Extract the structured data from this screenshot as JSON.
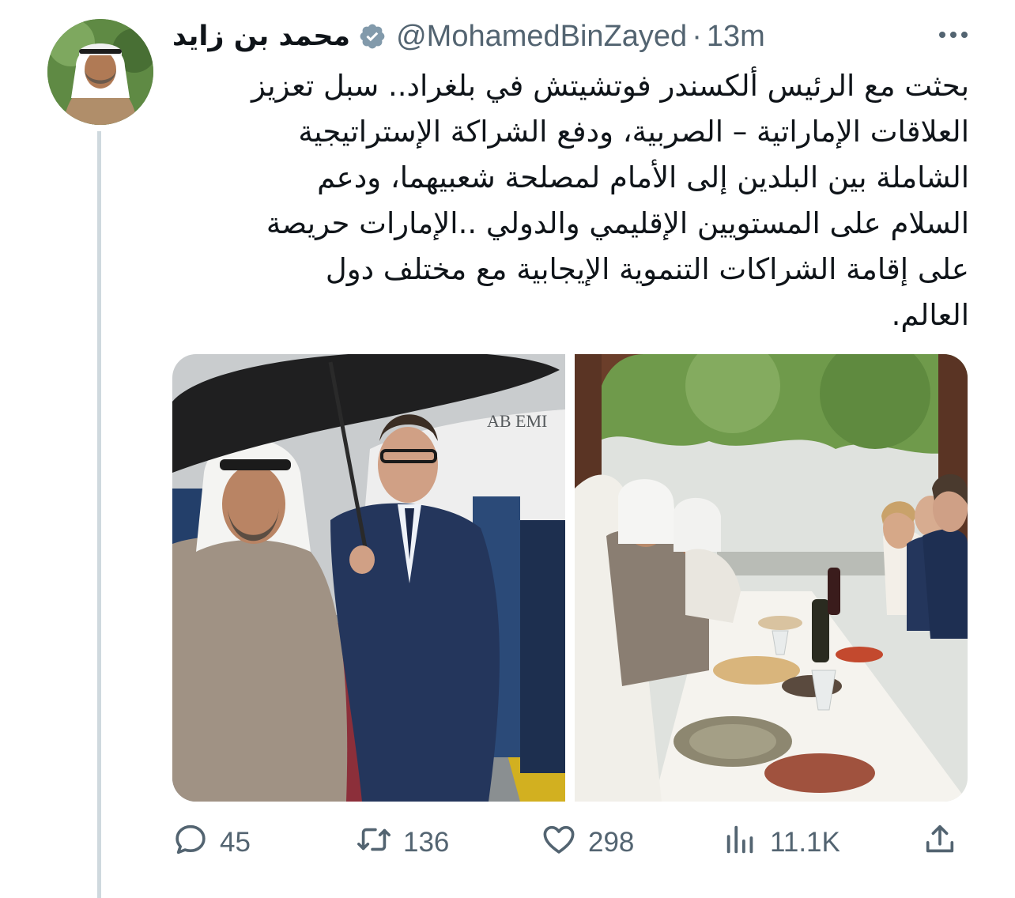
{
  "author": {
    "display_name": "محمد بن زايد",
    "verified": true,
    "handle": "@MohamedBinZayed",
    "separator": "·",
    "time": "13m"
  },
  "tweet": {
    "text": "بحثت مع الرئيس ألكسندر فوتشيتش في بلغراد.. سبل تعزيز العلاقات الإماراتية – الصربية، ودفع الشراكة الإستراتيجية الشاملة بين البلدين إلى الأمام لمصلحة شعبيهما، ودعم السلام على المستويين الإقليمي والدولي ..الإمارات حريصة على إقامة الشراكات التنموية الإيجابية مع مختلف دول العالم.",
    "lines": [
      "بحثت مع الرئيس ألكسندر فوتشيتش في بلغراد.. سبل تعزيز",
      "العلاقات الإماراتية – الصربية، ودفع الشراكة الإستراتيجية",
      "الشاملة بين البلدين إلى الأمام لمصلحة شعبيهما، ودعم",
      "السلام على المستويين الإقليمي والدولي ..الإمارات حريصة",
      "على إقامة الشراكات التنموية الإيجابية مع مختلف دول",
      "العالم."
    ],
    "photo_sign_text": "AB EMI"
  },
  "actions": {
    "replies": "45",
    "retweets": "136",
    "likes": "298",
    "views": "11.1K"
  },
  "icons": {
    "verified": "verified-badge-icon",
    "more": "more-icon",
    "reply": "reply-icon",
    "retweet": "retweet-icon",
    "like": "heart-icon",
    "views": "views-icon",
    "share": "share-icon"
  },
  "colors": {
    "text": "#0f1419",
    "secondary": "#536471",
    "thread_line": "#cfd9de"
  }
}
